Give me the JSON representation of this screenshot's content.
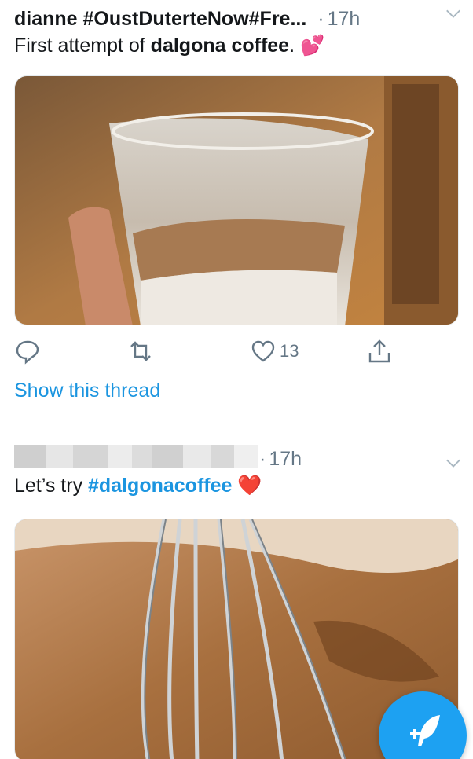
{
  "tweets": [
    {
      "author": "dianne #OustDuterteNow#Fre...",
      "dot": "·",
      "time": "17h",
      "text_plain": "First attempt of ",
      "text_bold": "dalgona coffee",
      "text_end": ".",
      "emoji": "💕",
      "media_icon": "dalgona-glass-photo",
      "actions": {
        "reply_icon": "reply-icon",
        "retweet_icon": "retweet-icon",
        "like_icon": "like-icon",
        "like_count": "13",
        "share_icon": "share-icon"
      },
      "thread_link": "Show this thread"
    },
    {
      "author_redacted": true,
      "dot": "·",
      "time": "17h",
      "text_plain": "Let’s try ",
      "hashtag": "#dalgonacoffee",
      "emoji": "❤️",
      "media_icon": "whisk-photo"
    }
  ],
  "fab": {
    "icon": "compose-tweet-icon"
  },
  "colors": {
    "link": "#1b95e0",
    "muted": "#657786",
    "fab": "#1da1f2"
  }
}
